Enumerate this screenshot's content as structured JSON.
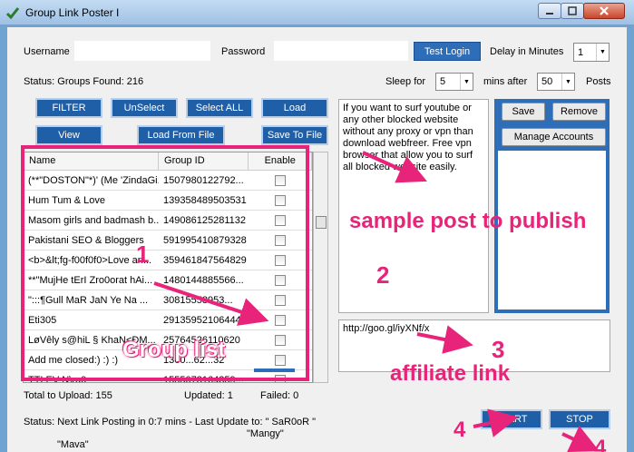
{
  "window": {
    "title": "Group Link Poster I"
  },
  "login": {
    "username_label": "Username",
    "password_label": "Password",
    "test_login_label": "Test Login",
    "delay_label": "Delay in Minutes",
    "delay_value": "1"
  },
  "status": {
    "groups_found": "Status:  Groups Found: 216",
    "sleep_label": "Sleep for",
    "sleep_value": "5",
    "mins_after_label": "mins after",
    "mins_after_value": "50",
    "posts_label": "Posts"
  },
  "toolbar": {
    "filter": "FILTER",
    "unselect": "UnSelect",
    "select_all": "Select ALL",
    "load": "Load",
    "view": "View",
    "load_from_file": "Load From File",
    "save_to_file": "Save To File"
  },
  "grid": {
    "headers": [
      "Name",
      "Group ID",
      "Enable"
    ],
    "rows": [
      {
        "name": "(**\"DOSTON\"*)' (Me 'ZindaGi...",
        "id": "1507980122792..."
      },
      {
        "name": "Hum Tum & Love",
        "id": "139358489503531"
      },
      {
        "name": "Masom girls and badmash b...",
        "id": "149086125281132"
      },
      {
        "name": "Pakistani SEO & Bloggers",
        "id": "591995410879328"
      },
      {
        "name": "<b>&lt;fg-f00f0f0>Love an...",
        "id": "359461847564829"
      },
      {
        "name": "**\"MujHe tErI Zro0orat hAi...",
        "id": "1480144885566..."
      },
      {
        "name": "\":::¶Gull MaR JaN Ye Na ...",
        "id": "30815558953..."
      },
      {
        "name": "Eti305",
        "id": "291359521064449"
      },
      {
        "name": "LøVêly s@hiL § KhaN<ÐM...",
        "id": "25764526110620"
      },
      {
        "name": "Add me closed:) :) :)",
        "id": "1360...62...32"
      },
      {
        "name": "TTLEV N\\ru0",
        "id": "1555078164359..."
      }
    ]
  },
  "totals": {
    "to_upload": "Total to Upload: 155",
    "updated": "Updated: 1",
    "failed": "Failed: 0"
  },
  "post": {
    "text": "If you want to surf youtube or any other blocked website without any proxy or vpn than download webfreer. Free vpn browser that allow you to surf all blocked website easily."
  },
  "link": {
    "text": "http://goo.gl/iyXNf/x"
  },
  "accounts": {
    "save": "Save",
    "remove": "Remove",
    "manage": "Manage Accounts"
  },
  "controls": {
    "start": "START",
    "stop": "STOP"
  },
  "footer": {
    "status_line": "Status:   Next Link Posting in 0:7 mins - Last Update to: \" SaR0oR \"",
    "line2": "\"Mangy\"",
    "line3": "\"Mava\""
  },
  "annotations": {
    "a1": "1",
    "a1_label": "Group list",
    "a2": "2",
    "a2_label": "sample post to publish",
    "a3": "3",
    "a3_label": "affiliate link",
    "a4": "4",
    "a4b": "4"
  },
  "colors": {
    "accent": "#2e6db8",
    "annotation": "#e8247a",
    "frame": "#6fa3d2"
  }
}
